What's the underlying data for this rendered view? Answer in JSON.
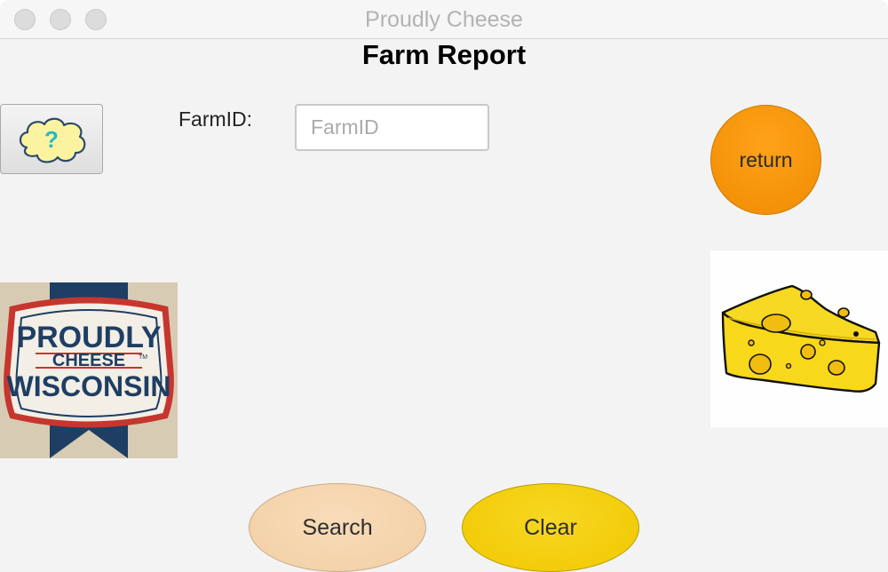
{
  "window": {
    "title": "Proudly Cheese"
  },
  "header": {
    "title": "Farm Report"
  },
  "help_button": {
    "icon": "question-cloud-icon",
    "symbol": "?"
  },
  "form": {
    "farm_id_label": "FarmID:",
    "farm_id_placeholder": "FarmID",
    "farm_id_value": ""
  },
  "buttons": {
    "return_label": "return",
    "search_label": "Search",
    "clear_label": "Clear"
  },
  "logo": {
    "line1": "PROUDLY",
    "line2": "CHEESE",
    "tm": "TM",
    "line3": "WISCONSIN"
  },
  "colors": {
    "return_button": "#f39400",
    "search_button": "#f4d4ab",
    "clear_button": "#f4cd0a",
    "logo_red": "#c6362f",
    "logo_navy": "#1f3e63"
  }
}
